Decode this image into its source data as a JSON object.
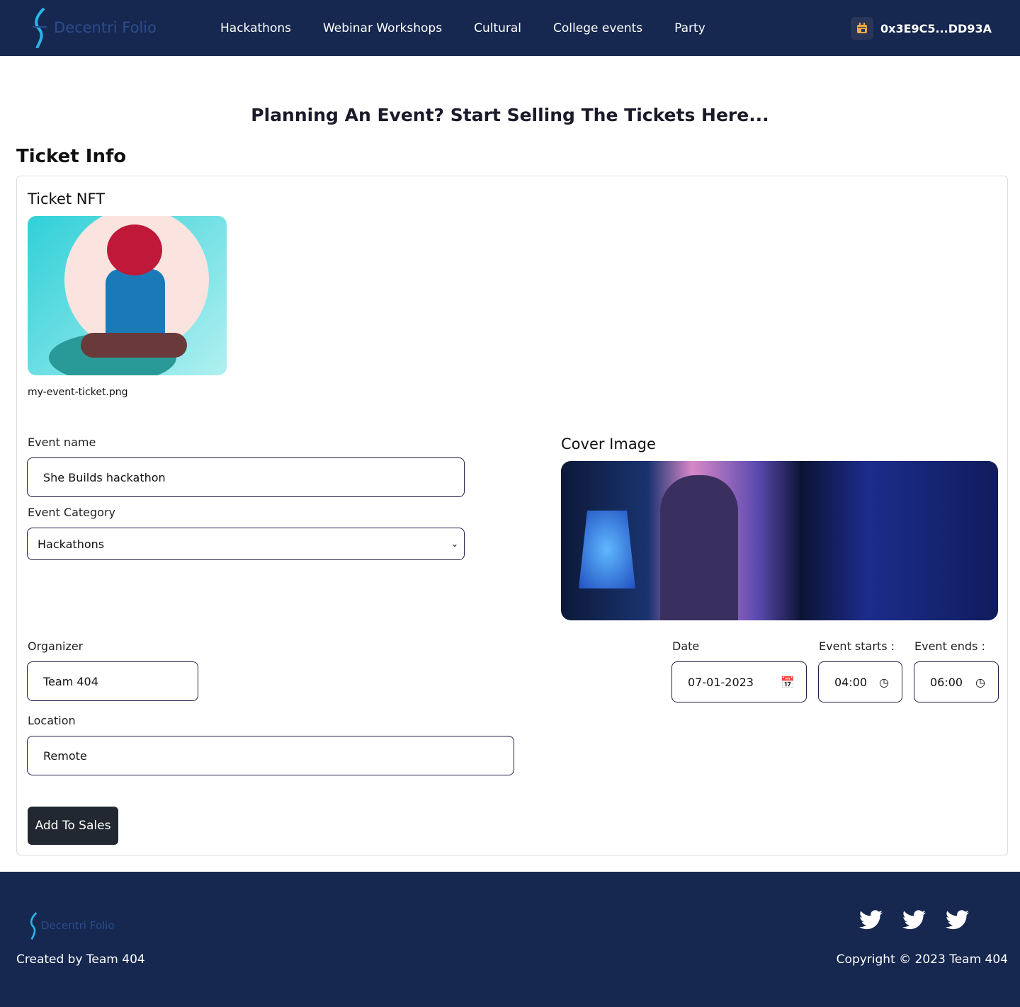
{
  "nav": {
    "brand": "Decentri Folio",
    "links": [
      "Hackathons",
      "Webinar Workshops",
      "Cultural",
      "College events",
      "Party"
    ],
    "wallet": "0x3E9C5...DD93A",
    "wallet_icon": "calendar-icon"
  },
  "headline": "Planning An Event? Start Selling The Tickets Here...",
  "section_title": "Ticket Info",
  "ticket": {
    "label": "Ticket NFT",
    "filename": "my-event-ticket.png"
  },
  "form": {
    "event_name_label": "Event name",
    "event_name": "She Builds hackathon",
    "category_label": "Event Category",
    "category": "Hackathons",
    "cover_label": "Cover Image",
    "organizer_label": "Organizer",
    "organizer": "Team 404",
    "location_label": "Location",
    "location": "Remote",
    "date_label": "Date",
    "date": "07-01-2023",
    "start_label": "Event starts :",
    "start": "04:00",
    "end_label": "Event ends :",
    "end": "06:00",
    "submit": "Add To Sales"
  },
  "footer": {
    "brand": "Decentri Folio",
    "credit": "Created by Team 404",
    "copyright": "Copyright © 2023 Team 404",
    "social_icons": [
      "twitter-icon",
      "twitter-icon",
      "twitter-icon"
    ]
  }
}
